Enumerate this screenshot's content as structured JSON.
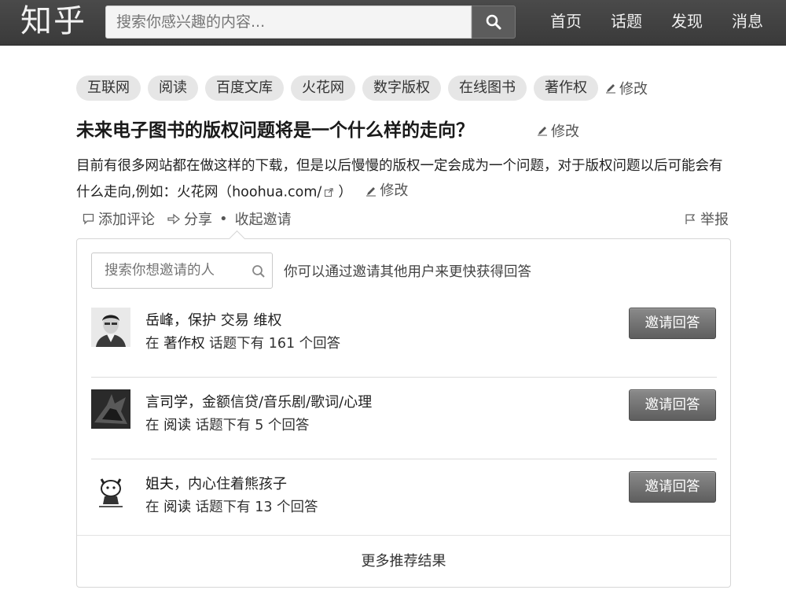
{
  "header": {
    "logo": "知乎",
    "search_placeholder": "搜索你感兴趣的内容...",
    "nav": [
      "首页",
      "话题",
      "发现",
      "消息"
    ]
  },
  "topics": {
    "tags": [
      "互联网",
      "阅读",
      "百度文库",
      "火花网",
      "数字版权",
      "在线图书",
      "著作权"
    ],
    "edit_label": "修改"
  },
  "question": {
    "title": "未来电子图书的版权问题将是一个什么样的走向？",
    "title_edit": "修改",
    "desc_text": "目前有很多网站都在做这样的下载，但是以后慢慢的版权一定会成为一个问题，对于版权问题以后可能会有什么走向,例如：火花网（",
    "desc_link": "hoohua.com/",
    "desc_close": "）",
    "desc_edit": "修改"
  },
  "actions": {
    "comment": "添加评论",
    "share": "分享",
    "dot": "•",
    "collapse_invite": "收起邀请",
    "report": "举报"
  },
  "invite": {
    "search_placeholder": "搜索你想邀请的人",
    "hint": "你可以通过邀请其他用户来更快获得回答",
    "users": [
      {
        "name": "岳峰",
        "bio": "，保护 交易 维权",
        "topic_prefix": "在 ",
        "topic": "著作权",
        "topic_suffix": " 话题下有 161 个回答",
        "button": "邀请回答"
      },
      {
        "name": "言司学",
        "bio": "，金额信贷/音乐剧/歌词/心理",
        "topic_prefix": "在 ",
        "topic": "阅读",
        "topic_suffix": " 话题下有 5 个回答",
        "button": "邀请回答"
      },
      {
        "name": "姐夫",
        "bio": "，内心住着熊孩子",
        "topic_prefix": "在 ",
        "topic": "阅读",
        "topic_suffix": " 话题下有 13 个回答",
        "button": "邀请回答"
      }
    ],
    "more": "更多推荐结果"
  }
}
